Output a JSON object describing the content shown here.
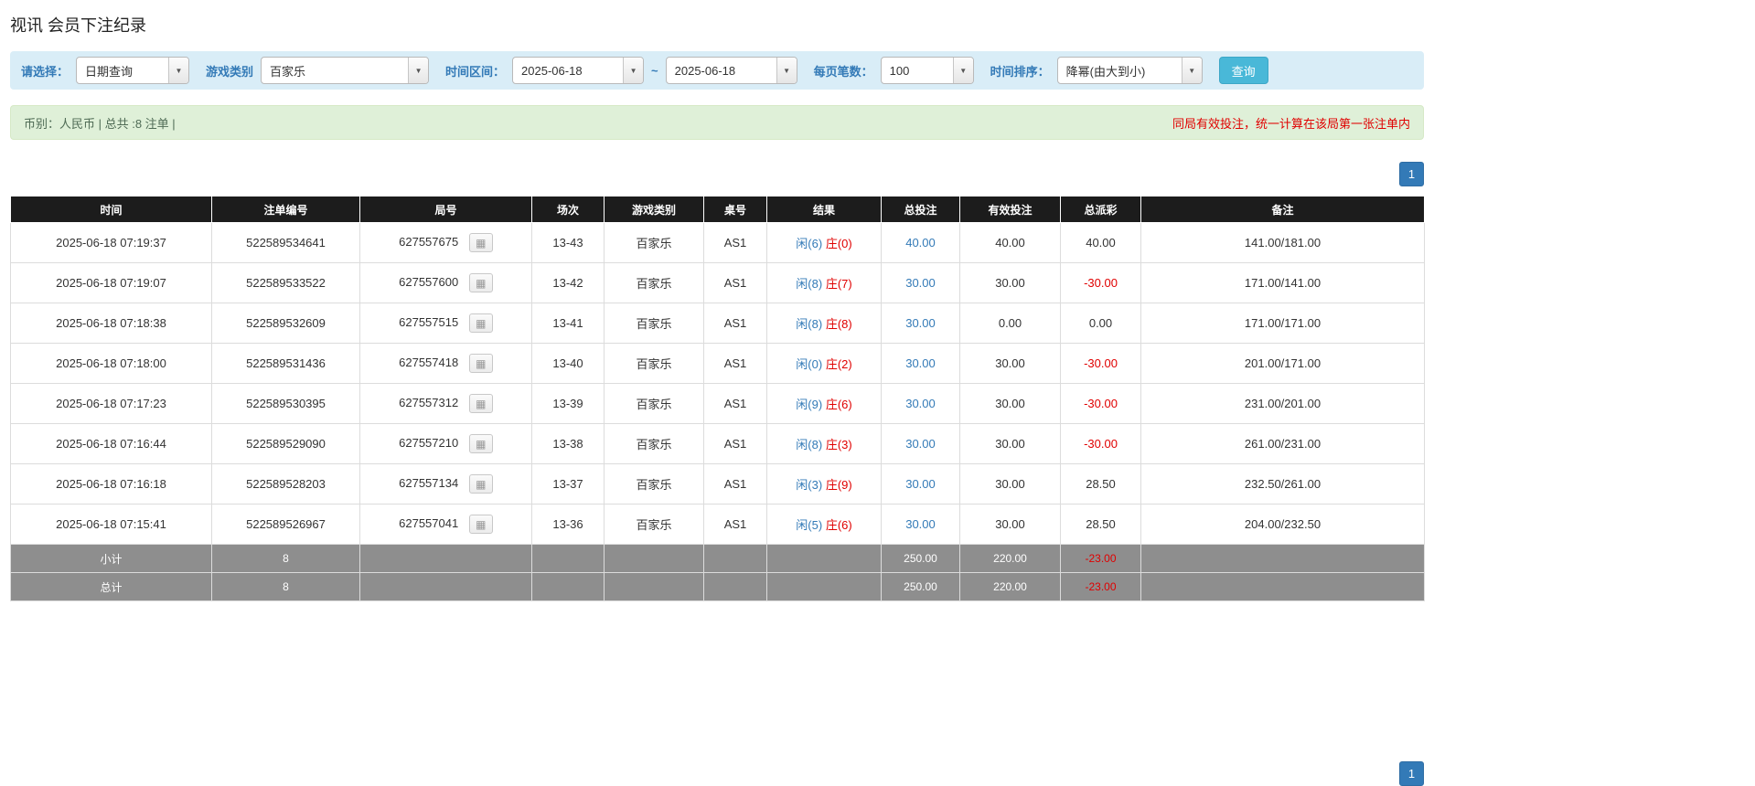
{
  "page": {
    "title": "视讯 会员下注纪录"
  },
  "filters": {
    "select_label": "请选择：",
    "select_value": "日期查询",
    "game_type_label": "游戏类别",
    "game_type_value": "百家乐",
    "time_range_label": "时间区间：",
    "date_from": "2025-06-18",
    "date_to": "2025-06-18",
    "range_separator": "~",
    "page_size_label": "每页笔数：",
    "page_size_value": "100",
    "sort_label": "时间排序：",
    "sort_value": "降幂(由大到小)",
    "search_button": "查询",
    "caret_glyph": "▼"
  },
  "summary": {
    "left": "币别：人民币 | 总共 :8 注单 |",
    "right": "同局有效投注，统一计算在该局第一张注单内"
  },
  "pagination": {
    "page": "1"
  },
  "icons": {
    "round_detail": "▦"
  },
  "colors": {
    "accent_blue": "#337ab7",
    "red": "#e00000",
    "header_black": "#1c1c1c",
    "footer_gray": "#8e8e8e",
    "filter_bg": "#d9edf7",
    "summary_bg": "#dff0d8",
    "search_btn": "#49b8d8"
  },
  "table": {
    "headers": [
      "时间",
      "注单编号",
      "局号",
      "场次",
      "游戏类别",
      "桌号",
      "结果",
      "总投注",
      "有效投注",
      "总派彩",
      "备注"
    ],
    "rows": [
      {
        "time": "2025-06-18 07:19:37",
        "bet_id": "522589534641",
        "round_id": "627557675",
        "session": "13-43",
        "game": "百家乐",
        "table_no": "AS1",
        "result_player": "闲(6)",
        "result_banker": "庄(0)",
        "total_bet": "40.00",
        "valid_bet": "40.00",
        "payout": "40.00",
        "note": "141.00/181.00"
      },
      {
        "time": "2025-06-18 07:19:07",
        "bet_id": "522589533522",
        "round_id": "627557600",
        "session": "13-42",
        "game": "百家乐",
        "table_no": "AS1",
        "result_player": "闲(8)",
        "result_banker": "庄(7)",
        "total_bet": "30.00",
        "valid_bet": "30.00",
        "payout": "-30.00",
        "note": "171.00/141.00"
      },
      {
        "time": "2025-06-18 07:18:38",
        "bet_id": "522589532609",
        "round_id": "627557515",
        "session": "13-41",
        "game": "百家乐",
        "table_no": "AS1",
        "result_player": "闲(8)",
        "result_banker": "庄(8)",
        "total_bet": "30.00",
        "valid_bet": "0.00",
        "payout": "0.00",
        "note": "171.00/171.00"
      },
      {
        "time": "2025-06-18 07:18:00",
        "bet_id": "522589531436",
        "round_id": "627557418",
        "session": "13-40",
        "game": "百家乐",
        "table_no": "AS1",
        "result_player": "闲(0)",
        "result_banker": "庄(2)",
        "total_bet": "30.00",
        "valid_bet": "30.00",
        "payout": "-30.00",
        "note": "201.00/171.00"
      },
      {
        "time": "2025-06-18 07:17:23",
        "bet_id": "522589530395",
        "round_id": "627557312",
        "session": "13-39",
        "game": "百家乐",
        "table_no": "AS1",
        "result_player": "闲(9)",
        "result_banker": "庄(6)",
        "total_bet": "30.00",
        "valid_bet": "30.00",
        "payout": "-30.00",
        "note": "231.00/201.00"
      },
      {
        "time": "2025-06-18 07:16:44",
        "bet_id": "522589529090",
        "round_id": "627557210",
        "session": "13-38",
        "game": "百家乐",
        "table_no": "AS1",
        "result_player": "闲(8)",
        "result_banker": "庄(3)",
        "total_bet": "30.00",
        "valid_bet": "30.00",
        "payout": "-30.00",
        "note": "261.00/231.00"
      },
      {
        "time": "2025-06-18 07:16:18",
        "bet_id": "522589528203",
        "round_id": "627557134",
        "session": "13-37",
        "game": "百家乐",
        "table_no": "AS1",
        "result_player": "闲(3)",
        "result_banker": "庄(9)",
        "total_bet": "30.00",
        "valid_bet": "30.00",
        "payout": "28.50",
        "note": "232.50/261.00"
      },
      {
        "time": "2025-06-18 07:15:41",
        "bet_id": "522589526967",
        "round_id": "627557041",
        "session": "13-36",
        "game": "百家乐",
        "table_no": "AS1",
        "result_player": "闲(5)",
        "result_banker": "庄(6)",
        "total_bet": "30.00",
        "valid_bet": "30.00",
        "payout": "28.50",
        "note": "204.00/232.50"
      }
    ],
    "subtotal": {
      "label": "小计",
      "count": "8",
      "total_bet": "250.00",
      "valid_bet": "220.00",
      "payout": "-23.00"
    },
    "total": {
      "label": "总计",
      "count": "8",
      "total_bet": "250.00",
      "valid_bet": "220.00",
      "payout": "-23.00"
    }
  }
}
